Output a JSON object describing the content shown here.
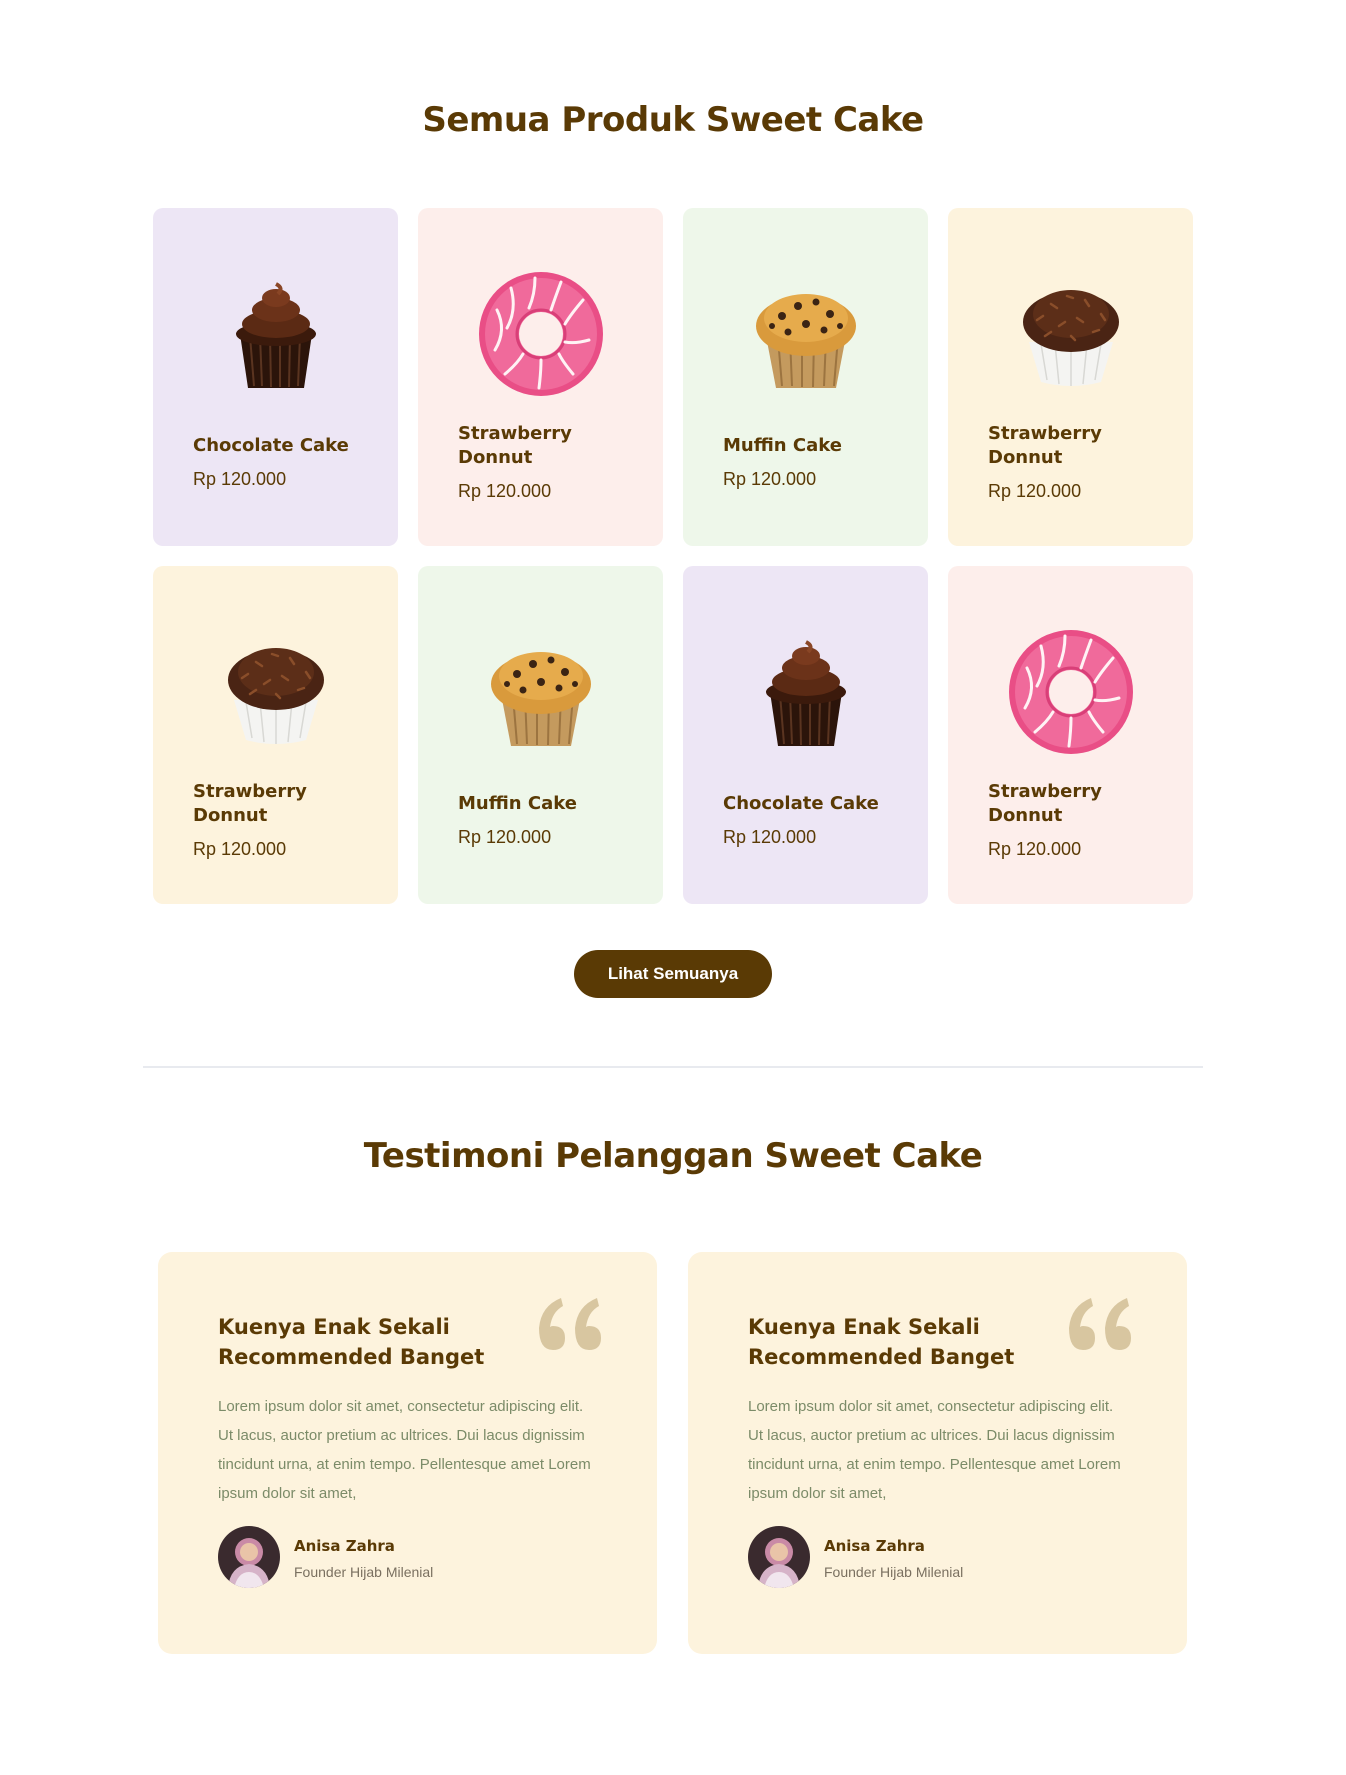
{
  "products": {
    "title": "Semua Produk Sweet Cake",
    "items": [
      {
        "name": "Chocolate Cake",
        "price": "Rp 120.000",
        "image": "chocolate-cupcake-image",
        "bg": "#ede6f5"
      },
      {
        "name": "Strawberry Donnut",
        "price": "Rp 120.000",
        "image": "pink-donut-image",
        "bg": "#fdeeeb"
      },
      {
        "name": "Muffin Cake",
        "price": "Rp 120.000",
        "image": "muffin-image",
        "bg": "#eef7ea"
      },
      {
        "name": "Strawberry Donnut",
        "price": "Rp 120.000",
        "image": "sprinkle-cupcake-image",
        "bg": "#fdf3dd"
      },
      {
        "name": "Strawberry Donnut",
        "price": "Rp 120.000",
        "image": "sprinkle-cupcake-image",
        "bg": "#fdf3dd"
      },
      {
        "name": "Muffin Cake",
        "price": "Rp 120.000",
        "image": "muffin-image",
        "bg": "#eef7ea"
      },
      {
        "name": "Chocolate Cake",
        "price": "Rp 120.000",
        "image": "chocolate-cupcake-image",
        "bg": "#ede6f5"
      },
      {
        "name": "Strawberry Donnut",
        "price": "Rp 120.000",
        "image": "pink-donut-image",
        "bg": "#fdeeeb"
      }
    ],
    "see_all_label": "Lihat Semuanya"
  },
  "testimonials": {
    "title": "Testimoni Pelanggan Sweet Cake",
    "items": [
      {
        "headline": "Kuenya Enak Sekali Recommended Banget",
        "body": "Lorem ipsum dolor sit amet, consectetur adipiscing elit. Ut lacus, auctor pretium ac ultrices. Dui lacus dignissim tincidunt urna, at enim tempo. Pellentesque amet Lorem ipsum dolor sit amet,",
        "author": "Anisa Zahra",
        "role": "Founder Hijab Milenial"
      },
      {
        "headline": "Kuenya Enak Sekali Recommended Banget",
        "body": "Lorem ipsum dolor sit amet, consectetur adipiscing elit. Ut lacus, auctor pretium ac ultrices. Dui lacus dignissim tincidunt urna, at enim tempo. Pellentesque amet Lorem ipsum dolor sit amet,",
        "author": "Anisa Zahra",
        "role": "Founder Hijab Milenial"
      }
    ]
  },
  "colors": {
    "brand_brown": "#5a3a05",
    "quote_mark": "#d8c6a0",
    "body_text": "#7b8b68"
  }
}
